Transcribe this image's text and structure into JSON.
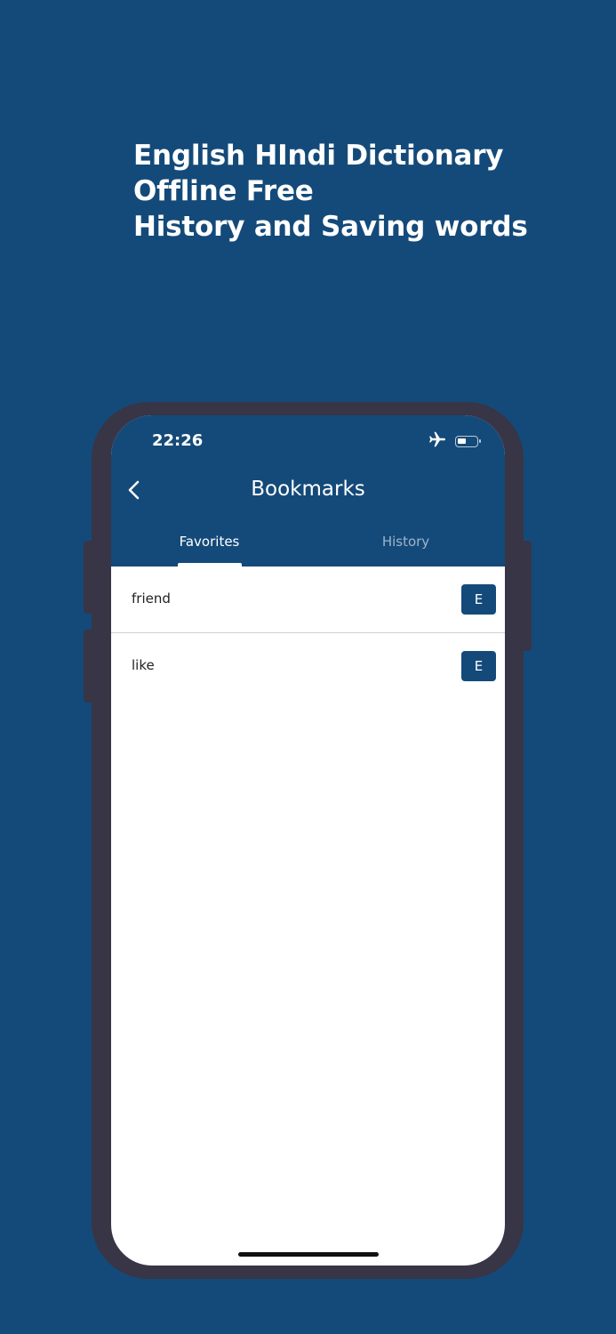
{
  "headline": {
    "line1": "English HIndi Dictionary",
    "line2": "Offline Free",
    "line3": "History and Saving words"
  },
  "status_bar": {
    "time": "22:26",
    "icons": [
      "airplane-mode-icon",
      "battery-icon"
    ]
  },
  "app_bar": {
    "back_icon": "chevron-left-icon",
    "title": "Bookmarks"
  },
  "tabs": [
    {
      "label": "Favorites",
      "selected": true
    },
    {
      "label": "History",
      "selected": false
    }
  ],
  "favorites": [
    {
      "word": "friend",
      "badge": "E"
    },
    {
      "word": "like",
      "badge": "E"
    }
  ],
  "colors": {
    "background": "#144a79",
    "accent": "#144a79",
    "phone_frame": "#373546",
    "tab_inactive": "#9fb4c9"
  }
}
